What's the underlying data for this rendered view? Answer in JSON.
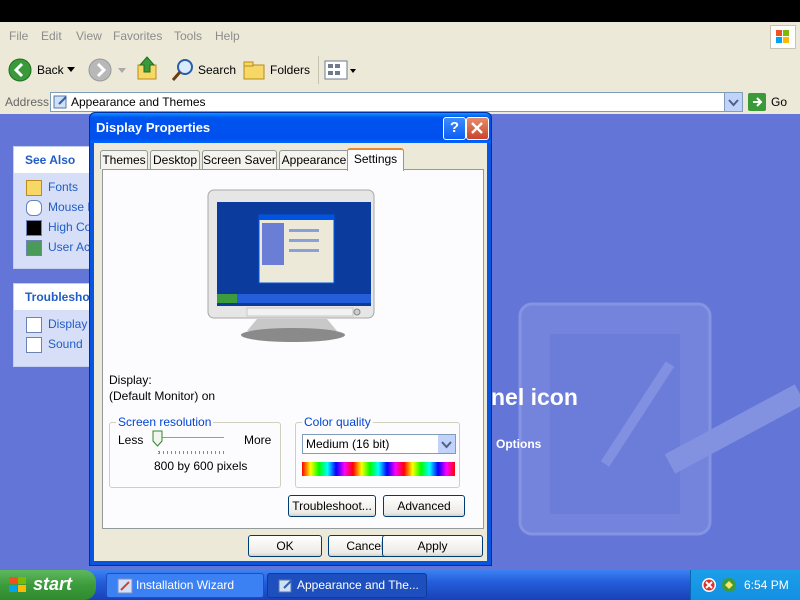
{
  "menu": [
    "File",
    "Edit",
    "View",
    "Favorites",
    "Tools",
    "Help"
  ],
  "toolbar": {
    "back": "Back",
    "search": "Search",
    "folders": "Folders"
  },
  "address": {
    "label": "Address",
    "value": "Appearance and Themes",
    "go": "Go"
  },
  "see_also": {
    "title": "See Also",
    "items": [
      "Fonts",
      "Mouse Pointers",
      "High Contrast",
      "User Account Picture"
    ]
  },
  "troubleshooters": {
    "title": "Troubleshooters",
    "items": [
      "Display",
      "Sound"
    ]
  },
  "background": {
    "heading_fragment": "nel icon",
    "link_fragment": "Options"
  },
  "dialog": {
    "title": "Display Properties",
    "tabs": [
      "Themes",
      "Desktop",
      "Screen Saver",
      "Appearance",
      "Settings"
    ],
    "active_tab": "Settings",
    "display_label": "Display:",
    "display_value": "(Default Monitor) on",
    "resolution": {
      "title": "Screen resolution",
      "less": "Less",
      "more": "More",
      "value_text": "800 by 600 pixels",
      "slider_level": 0.0
    },
    "color": {
      "title": "Color quality",
      "selected": "Medium (16 bit)"
    },
    "buttons": {
      "troubleshoot": "Troubleshoot...",
      "advanced": "Advanced",
      "ok": "OK",
      "cancel": "Cancel",
      "apply": "Apply"
    }
  },
  "taskbar": {
    "start": "start",
    "tasks": [
      "Installation Wizard",
      "Appearance and The..."
    ],
    "time": "6:54 PM"
  },
  "colors": {
    "xp_blue": "#0054e3",
    "content_bg": "#6375d6",
    "taskbar": "#245edb",
    "start_green": "#3c9c3c"
  }
}
